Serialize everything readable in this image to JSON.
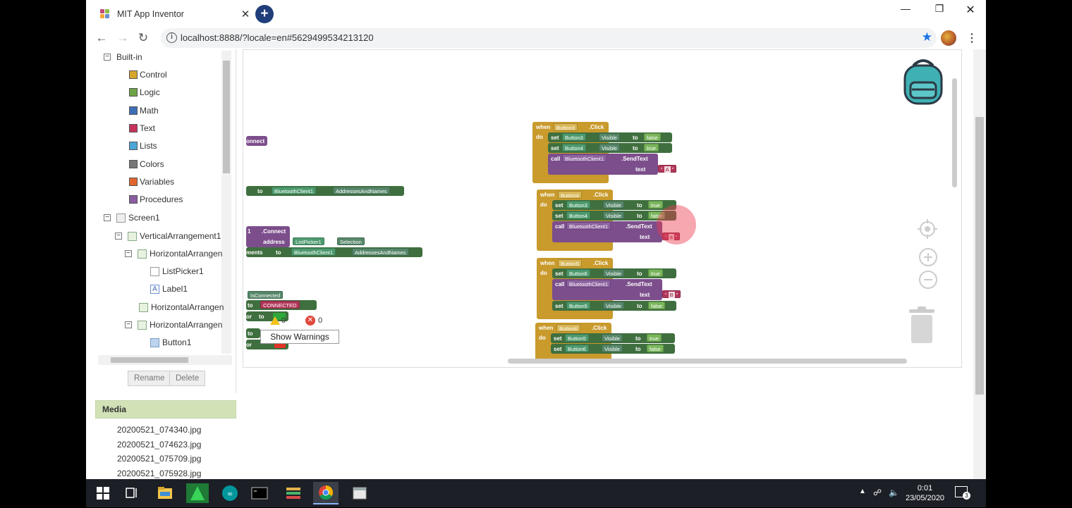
{
  "browser": {
    "tab_title": "MIT App Inventor",
    "tab_close": "✕",
    "new_tab": "+",
    "url": "localhost:8888/?locale=en#5629499534213120",
    "window_controls": {
      "minimize": "—",
      "restore": "❐",
      "close": "✕"
    }
  },
  "palette": {
    "builtin_label": "Built-in",
    "builtin_items": [
      {
        "label": "Control",
        "color": "#d8a52b"
      },
      {
        "label": "Logic",
        "color": "#6fa446"
      },
      {
        "label": "Math",
        "color": "#3c6fb8"
      },
      {
        "label": "Text",
        "color": "#c6325a"
      },
      {
        "label": "Lists",
        "color": "#4aa7d7"
      },
      {
        "label": "Colors",
        "color": "#777777"
      },
      {
        "label": "Variables",
        "color": "#e0662e"
      },
      {
        "label": "Procedures",
        "color": "#8a5ca0"
      }
    ],
    "components": [
      {
        "label": "Screen1"
      },
      {
        "label": "VerticalArrangement1"
      },
      {
        "label": "HorizontalArrangen"
      },
      {
        "label": "ListPicker1"
      },
      {
        "label": "Label1"
      },
      {
        "label": "HorizontalArrangen"
      },
      {
        "label": "HorizontalArrangen"
      },
      {
        "label": "Button1"
      }
    ],
    "rename_label": "Rename",
    "delete_label": "Delete"
  },
  "media": {
    "heading": "Media",
    "files": [
      "20200521_074340.jpg",
      "20200521_074623.jpg",
      "20200521_075709.jpg",
      "20200521_075928.jpg"
    ]
  },
  "workspace": {
    "left_fragments": {
      "connect_tail": "onnect",
      "to_kw": "to",
      "bt_client": "BluetoothClient1",
      "addresses": "AddressesAndNames",
      "connect_call": ".Connect",
      "one": "1",
      "address_kw": "address",
      "listpicker": "ListPicker1",
      "selection": "Selection",
      "ments": "ments",
      "isconnected": "IsConnected",
      "connected_text": "CONNECTED",
      "or_kw": "or",
      "to_kw2": "to"
    },
    "events": [
      {
        "when": "when",
        "do": "do",
        "component": "Button3",
        "event": ".Click",
        "statements": [
          {
            "kind": "set",
            "kw": "set",
            "comp": "Button3",
            "prop": "Visible",
            "to": "to",
            "value": "false"
          },
          {
            "kind": "set",
            "kw": "set",
            "comp": "Button4",
            "prop": "Visible",
            "to": "to",
            "value": "true"
          },
          {
            "kind": "call",
            "kw": "call",
            "comp": "BluetoothClient1",
            "method": ".SendText",
            "arg": "text",
            "value": "A"
          }
        ]
      },
      {
        "when": "when",
        "do": "do",
        "component": "Button4",
        "event": ".Click",
        "statements": [
          {
            "kind": "set",
            "kw": "set",
            "comp": "Button3",
            "prop": "Visible",
            "to": "to",
            "value": "true"
          },
          {
            "kind": "set",
            "kw": "set",
            "comp": "Button4",
            "prop": "Visible",
            "to": "to",
            "value": "false"
          },
          {
            "kind": "call",
            "kw": "call",
            "comp": "BluetoothClient1",
            "method": ".SendText",
            "arg": "text",
            "value": "a"
          }
        ]
      },
      {
        "when": "when",
        "do": "do",
        "component": "Button5",
        "event": ".Click",
        "statements": [
          {
            "kind": "set",
            "kw": "set",
            "comp": "Button6",
            "prop": "Visible",
            "to": "to",
            "value": "true"
          },
          {
            "kind": "call",
            "kw": "call",
            "comp": "BluetoothClient1",
            "method": ".SendText",
            "arg": "text",
            "value": "B"
          },
          {
            "kind": "set",
            "kw": "set",
            "comp": "Button5",
            "prop": "Visible",
            "to": "to",
            "value": "false"
          }
        ]
      },
      {
        "when": "when",
        "do": "do",
        "component": "Button6",
        "event": ".Click",
        "statements": [
          {
            "kind": "set",
            "kw": "set",
            "comp": "Button5",
            "prop": "Visible",
            "to": "to",
            "value": "true"
          },
          {
            "kind": "set",
            "kw": "set",
            "comp": "Button6",
            "prop": "Visible",
            "to": "to",
            "value": "false"
          }
        ]
      }
    ],
    "warnings_count": "0",
    "errors_count": "0",
    "show_warnings_label": "Show Warnings"
  },
  "taskbar": {
    "time": "0:01",
    "date": "23/05/2020",
    "notification_count": "3"
  },
  "colors": {
    "event_block": "#c99a2c",
    "set_block": "#3f6f3e",
    "call_block": "#7c4e8c",
    "text_block": "#b1375a",
    "logic_block": "#7ab55c",
    "backpack": "#3fb0b4"
  }
}
